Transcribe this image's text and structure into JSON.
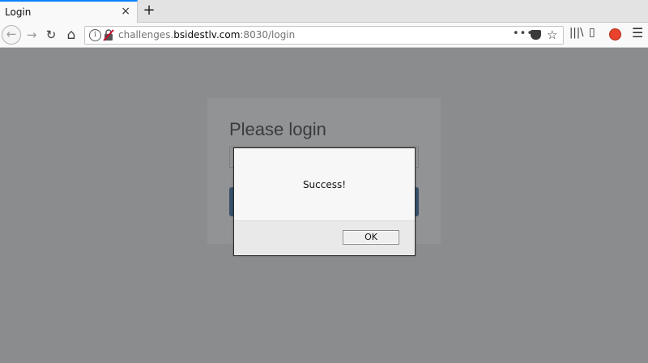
{
  "browser": {
    "tab": {
      "title": "Login",
      "close": "×"
    },
    "new_tab": "+",
    "nav": {
      "back": "←",
      "forward": "→",
      "reload": "↻",
      "home": "⌂"
    },
    "url": {
      "prefix": "challenges.",
      "host": "bsidestlv.com",
      "suffix": ":8030/login"
    },
    "url_actions": {
      "more": "•••",
      "star": "☆"
    },
    "toolbar": {
      "library": "|||\\",
      "sidebar": "▯",
      "menu": "☰"
    }
  },
  "page": {
    "login": {
      "heading": "Please login"
    }
  },
  "dialog": {
    "message": "Success!",
    "ok_label": "OK"
  },
  "colors": {
    "accent": "#0a84ff",
    "overlay": "#8b8c8e",
    "login_button": "#38506a"
  }
}
